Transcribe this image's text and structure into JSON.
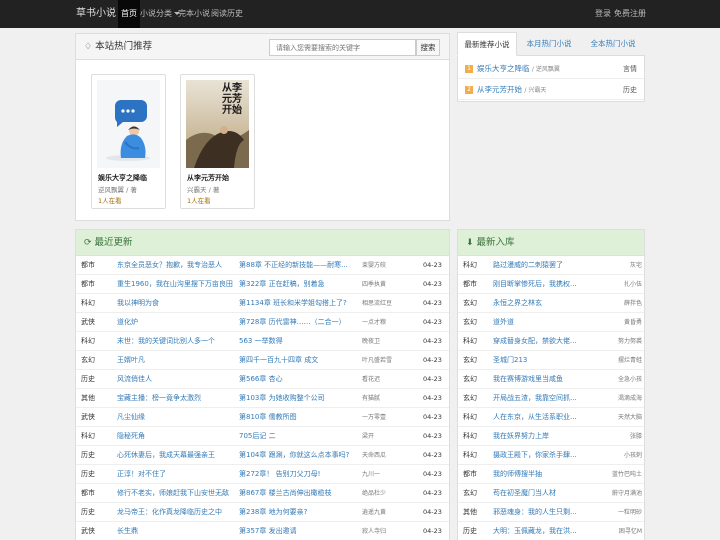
{
  "nav": {
    "brand": "草书小说",
    "items": [
      {
        "label": "首页",
        "active": true
      },
      {
        "label": "小说分类",
        "dropdown": true
      },
      {
        "label": "完本小说"
      },
      {
        "label": "阅读历史"
      }
    ],
    "login": "登录",
    "register": "免费注册"
  },
  "recommend": {
    "title": "本站热门推荐",
    "search_placeholder": "请输入您需要搜索的关键字",
    "search_button": "搜索",
    "books": [
      {
        "title": "娱乐大亨之降临",
        "author": "逆风飘翼 / 著",
        "readers": "1人在看"
      },
      {
        "title": "从李元芳开始",
        "author": "兴霸天 / 著",
        "readers": "1人在看",
        "cover_text": "从李元芳开始"
      }
    ]
  },
  "hot_tabs": {
    "tabs": [
      "最新推荐小说",
      "本月热门小说",
      "全本热门小说"
    ],
    "items": [
      {
        "rank": "1",
        "title": "娱乐大亨之降临",
        "author": "/ 逆风飘翼",
        "category": "言情"
      },
      {
        "rank": "2",
        "title": "从李元芳开始",
        "author": "/ 兴霸天",
        "category": "历史"
      }
    ]
  },
  "updates": {
    "title": "最近更新",
    "rows": [
      [
        "都市",
        "东京全员恶女？抱歉，我专治恶人",
        "第88章 不正经的新技能——耐寒...",
        "束婴方皎",
        "04-23"
      ],
      [
        "都市",
        "重生1960，我在山沟里摆下万亩良田",
        "第322章 正在赶稿，别着急",
        "四季执黄",
        "04-23"
      ],
      [
        "科幻",
        "我以神明为食",
        "第1134章 班长和米学姐勾搭上了?",
        "相思流红豆",
        "04-23"
      ],
      [
        "武侠",
        "道化炉",
        "第728章 历代雷神……（二合一）",
        "一点才粮",
        "04-23"
      ],
      [
        "科幻",
        "末世：我的关键词比别人多一个",
        "563 一举数得",
        "晚夜卫",
        "04-23"
      ],
      [
        "玄幻",
        "王婿叶凡",
        "第四千一百九十四章 成文",
        "叶凡盛若雪",
        "04-23"
      ],
      [
        "历史",
        "风流俏佳人",
        "第566章 杏心",
        "看花迟",
        "04-23"
      ],
      [
        "其他",
        "宝藏主播：榜一竟争太激烈",
        "第103章 为她收购整个公司",
        "有猫腻",
        "04-23"
      ],
      [
        "武侠",
        "凡尘仙缘",
        "第810章 儒教所图",
        "一万零壹",
        "04-23"
      ],
      [
        "科幻",
        "隐秘死角",
        "705后记 二",
        "梁开",
        "04-23"
      ],
      [
        "历史",
        "心死休妻后，我成天幕最强亲王",
        "第104章 跟涮，你就这么点本事吗?",
        "天命西瓜",
        "04-23"
      ],
      [
        "历史",
        "正淳！对不住了",
        "第272章！ 告别刀父刀母!",
        "九川一",
        "04-23"
      ],
      [
        "都市",
        "修行不老实，师娘赶我下山安世无敌",
        "第867章 楼兰古尚伸出橄榄枝",
        "绝品杜少",
        "04-23"
      ],
      [
        "历史",
        "龙马帝王：化作真龙降临历史之中",
        "第238章 地为何要亲?",
        "逍遥九黄",
        "04-23"
      ],
      [
        "武侠",
        "长生鼎",
        "第357章 发出邀请",
        "寂人寺归",
        "04-23"
      ]
    ]
  },
  "latest": {
    "title": "最新入库",
    "rows": [
      [
        "科幻",
        "路过漫威的二刺猿罢了",
        "灰宅"
      ],
      [
        "都市",
        "刚目断掌惨死后，我携权...",
        "扎小伍"
      ],
      [
        "玄幻",
        "永恒之界之林玄",
        "薛拌色"
      ],
      [
        "玄幻",
        "道外道",
        "黄昏勇"
      ],
      [
        "科幻",
        "穿成替身女配，禁欲大佬...",
        "努力努裘"
      ],
      [
        "玄幻",
        "圣城门213",
        "摆烂青蛙"
      ],
      [
        "玄幻",
        "我在赛博游戏里当咸鱼",
        "全急小孩"
      ],
      [
        "玄幻",
        "开局战五渣，我靠空间抓...",
        "渴滴成海"
      ],
      [
        "科幻",
        "人在东京，从生活系职业...",
        "天然大脑"
      ],
      [
        "科幻",
        "我在妖界努力上岸",
        "张膝"
      ],
      [
        "科幻",
        "摄政王殿下，你家杀手肆...",
        "小孩刺"
      ],
      [
        "都市",
        "我的师傅搜半抽",
        "蓝竹巴吨土"
      ],
      [
        "玄幻",
        "苟在初圣魔门当人材",
        "蔚守月满池"
      ],
      [
        "其他",
        "邪恶魂身：我的人生只剩...",
        "一粒明砂"
      ],
      [
        "历史",
        "大明：玉佩藏龙，我在洪...",
        "困寻忆M"
      ]
    ]
  }
}
